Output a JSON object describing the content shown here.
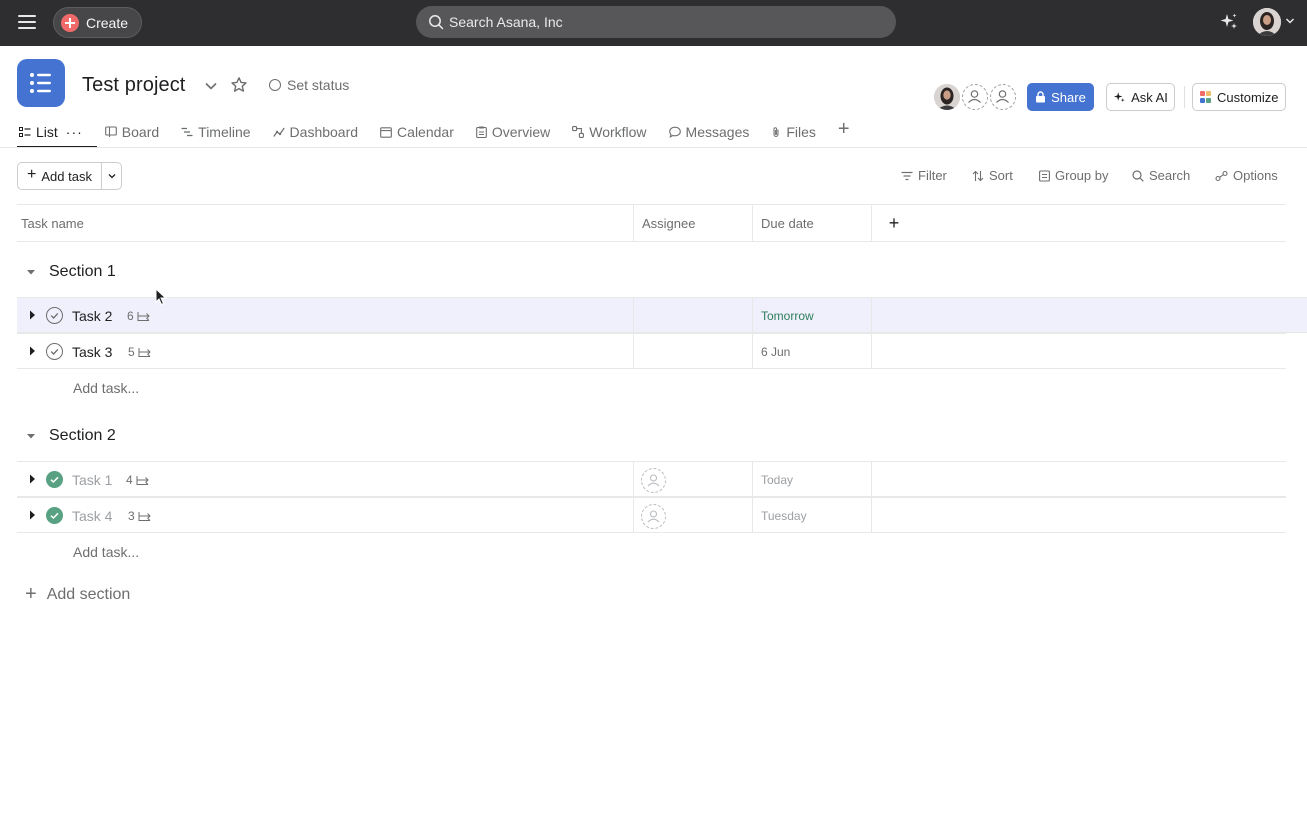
{
  "topbar": {
    "create_label": "Create",
    "search_placeholder": "Search Asana, Inc"
  },
  "project": {
    "title": "Test project",
    "set_status_label": "Set status"
  },
  "header_buttons": {
    "share": "Share",
    "ask_ai": "Ask AI",
    "customize": "Customize"
  },
  "tabs": [
    {
      "label": "List",
      "icon": "list-icon",
      "active": true
    },
    {
      "label": "Board",
      "icon": "board-icon"
    },
    {
      "label": "Timeline",
      "icon": "timeline-icon"
    },
    {
      "label": "Dashboard",
      "icon": "dashboard-icon"
    },
    {
      "label": "Calendar",
      "icon": "calendar-icon"
    },
    {
      "label": "Overview",
      "icon": "overview-icon"
    },
    {
      "label": "Workflow",
      "icon": "workflow-icon"
    },
    {
      "label": "Messages",
      "icon": "messages-icon"
    },
    {
      "label": "Files",
      "icon": "paperclip-icon"
    }
  ],
  "toolbar": {
    "add_task": "Add task",
    "filter": "Filter",
    "sort": "Sort",
    "group_by": "Group by",
    "search": "Search",
    "options": "Options"
  },
  "columns": {
    "task_name": "Task name",
    "assignee": "Assignee",
    "due_date": "Due date"
  },
  "sections": [
    {
      "title": "Section 1",
      "tasks": [
        {
          "name": "Task 2",
          "subtasks": "6",
          "due": "Tomorrow",
          "done": false
        },
        {
          "name": "Task 3",
          "subtasks": "5",
          "due": "6 Jun",
          "done": false
        }
      ],
      "add_task": "Add task..."
    },
    {
      "title": "Section 2",
      "tasks": [
        {
          "name": "Task 1",
          "subtasks": "4",
          "due": "Today",
          "done": true
        },
        {
          "name": "Task 4",
          "subtasks": "3",
          "due": "Tuesday",
          "done": true
        }
      ],
      "add_task": "Add task..."
    }
  ],
  "add_section": "Add section",
  "colors": {
    "topbar_bg": "#2e2e30",
    "accent_blue": "#4573d2",
    "create_red": "#f06a6a",
    "done_green": "#58a182",
    "row_hover": "#eff0fb"
  }
}
